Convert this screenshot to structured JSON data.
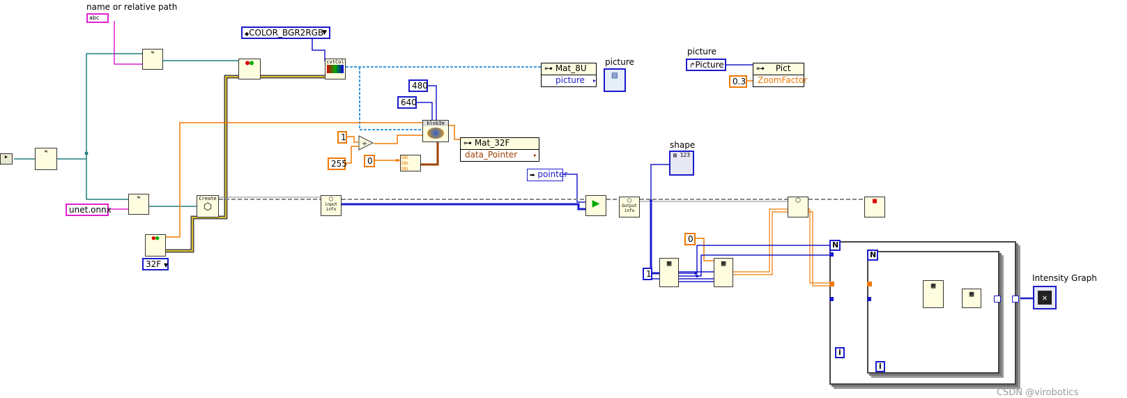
{
  "labels": {
    "name_path": "name or relative path",
    "picture_top": "picture",
    "picture_ctrl": "picture",
    "shape": "shape",
    "intensity_graph": "Intensity Graph"
  },
  "constants": {
    "color_enum": "COLOR_BGR2RGB",
    "onnx_file": "unet.onnx",
    "mat_type": "32F",
    "height": "480",
    "width": "640",
    "one": "1",
    "zero_a": "0",
    "scale": "255",
    "zoom": "0.3",
    "zero_b": "0",
    "one_b": "1"
  },
  "property_nodes": {
    "mat8u_head": "Mat_8U",
    "mat8u_row": "picture",
    "mat32f_head": "Mat_32F",
    "mat32f_row": "data_Pointer",
    "pict_head": "Pict",
    "pict_row": "ZoomFactor",
    "picture_ref": "Picture",
    "pointer": "pointer"
  },
  "vi_text": {
    "cvtcol": "cvtCol",
    "create": "Create",
    "blob": "blobIm",
    "input_info": "input info",
    "output_info": "Output info",
    "dbl": "DBL"
  },
  "loop_terms": {
    "n_outer": "N",
    "n_inner": "N",
    "i_outer": "i",
    "i_inner": "i"
  },
  "watermark": "CSDN @virobotics",
  "colors": {
    "wire_teal": "#1f7f7f",
    "wire_pink": "#e020d0",
    "wire_blue": "#1a1acc",
    "wire_orange": "#f07800",
    "wire_lightblue": "#3a9ae0",
    "wire_gray": "#888888",
    "node_fill": "#fffde0"
  }
}
